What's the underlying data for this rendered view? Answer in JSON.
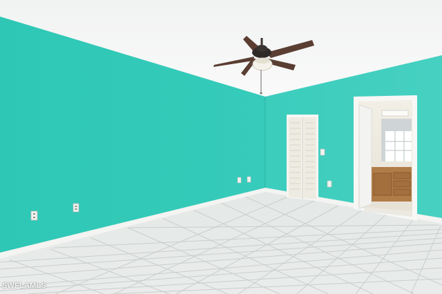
{
  "watermark": {
    "text": "SWFLAMLS"
  },
  "colors": {
    "wall_left": "#2fc8b6",
    "wall_right": "#3fcfbf",
    "ceiling": "#f3f4f4",
    "floor": "#dfe3e1",
    "grout": "#c8cdcb",
    "baseboard": "#f4f4f2",
    "closet_door": "#f1efe6",
    "door_frame": "#f6f6f4",
    "fan_blade": "#5a3e32",
    "vanity_wood": "#b07c48"
  },
  "icons": [
    "ceiling-fan-icon",
    "outlet-icon",
    "light-switch-icon"
  ]
}
